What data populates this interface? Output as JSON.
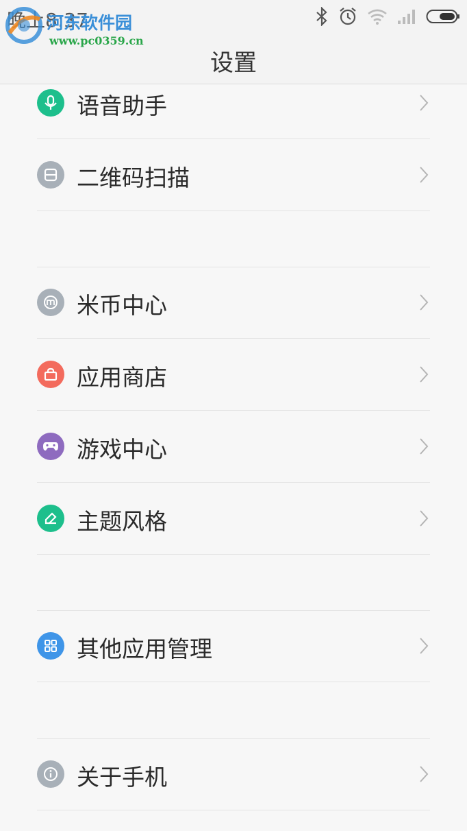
{
  "status_bar": {
    "time": "晚上8:37",
    "icons": [
      "bluetooth-icon",
      "alarm-icon",
      "wifi-icon",
      "signal-icon",
      "battery-icon"
    ]
  },
  "watermark": {
    "name": "河东软件园",
    "url": "www.pc0359.cn"
  },
  "header": {
    "title": "设置"
  },
  "items": [
    {
      "id": "voice-assistant",
      "label": "语音助手",
      "icon": "microphone-icon",
      "color": "#1dbf8c"
    },
    {
      "id": "qr-scan",
      "label": "二维码扫描",
      "icon": "scan-icon",
      "color": "#a8b0b8"
    },
    {
      "id": "mi-coin",
      "label": "米币中心",
      "icon": "mi-coin-icon",
      "color": "#a8b0b8"
    },
    {
      "id": "app-store",
      "label": "应用商店",
      "icon": "shopping-bag-icon",
      "color": "#f36b5d"
    },
    {
      "id": "game-center",
      "label": "游戏中心",
      "icon": "gamepad-icon",
      "color": "#8e6bbf"
    },
    {
      "id": "themes",
      "label": "主题风格",
      "icon": "brush-icon",
      "color": "#1dbf8c"
    },
    {
      "id": "other-apps",
      "label": "其他应用管理",
      "icon": "apps-grid-icon",
      "color": "#3f95e8"
    },
    {
      "id": "about-phone",
      "label": "关于手机",
      "icon": "info-icon",
      "color": "#a8b0b8"
    }
  ]
}
